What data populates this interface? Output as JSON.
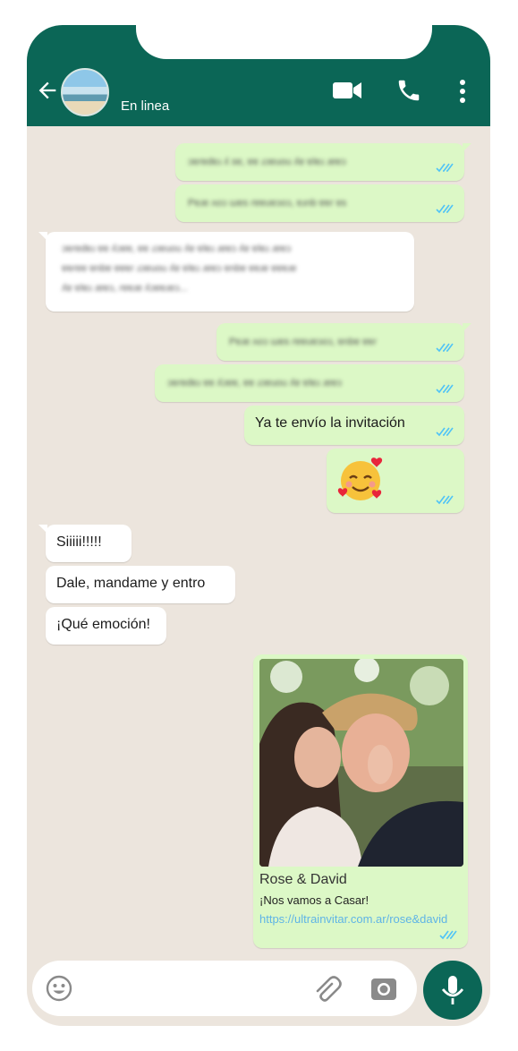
{
  "header": {
    "status": "En linea",
    "icons": [
      "back-arrow-icon",
      "video-call-icon",
      "phone-call-icon",
      "more-vert-icon"
    ]
  },
  "messages": [
    {
      "direction": "out",
      "blurred": true,
      "status": "read"
    },
    {
      "direction": "out",
      "blurred": true,
      "status": "read"
    },
    {
      "direction": "in",
      "blurred": true
    },
    {
      "direction": "out",
      "blurred": true,
      "status": "read"
    },
    {
      "direction": "out",
      "blurred": true,
      "status": "read"
    },
    {
      "direction": "out",
      "text": "Ya te envío la invitación",
      "status": "read"
    },
    {
      "direction": "out",
      "emoji": "smiling-face-with-hearts",
      "status": "read"
    },
    {
      "direction": "in",
      "text": "Siiiii!!!!!"
    },
    {
      "direction": "in",
      "text": "Dale, mandame y entro"
    },
    {
      "direction": "in",
      "text": "¡Qué emoción!"
    },
    {
      "direction": "out",
      "type": "link-preview",
      "title": "Rose & David",
      "subtitle": "¡Nos vamos a Casar!",
      "link": "https://ultrainvitar.com.ar/rose&david",
      "status": "read"
    }
  ],
  "composer": {
    "icons": [
      "emoji-icon",
      "attach-icon",
      "camera-icon",
      "mic-icon"
    ]
  },
  "colors": {
    "header": "#0b6656",
    "background": "#ece5dd",
    "outgoing_bubble": "#dcf8c6",
    "incoming_bubble": "#ffffff",
    "read_ticks": "#4fc3f7",
    "link": "#5fb4e6"
  }
}
